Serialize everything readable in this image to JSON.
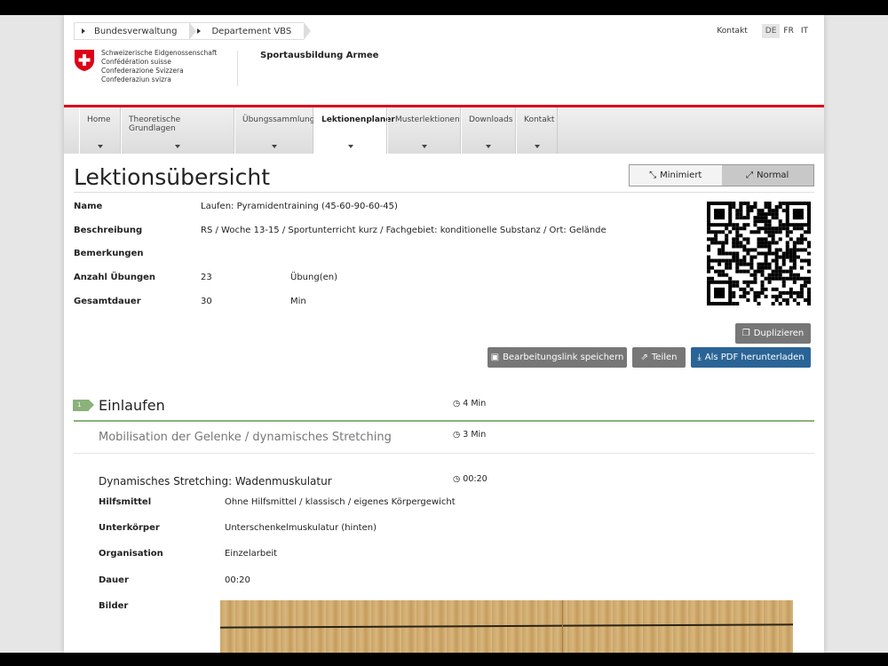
{
  "breadcrumbs": [
    "Bundesverwaltung",
    "Departement VBS"
  ],
  "top_links": {
    "kontakt": "Kontakt",
    "languages": [
      "DE",
      "FR",
      "IT"
    ],
    "active_language": "DE"
  },
  "federation": [
    "Schweizerische Eidgenossenschaft",
    "Confédération suisse",
    "Confederazione Svizzera",
    "Confederaziun svizra"
  ],
  "site_title": "Sportausbildung Armee",
  "nav": [
    "Home",
    "Theoretische Grundlagen",
    "Übungssammlung",
    "Lektionenplaner",
    "Musterlektionen",
    "Downloads",
    "Kontakt"
  ],
  "nav_active": "Lektionenplaner",
  "page_title": "Lektionsübersicht",
  "view_toggle": {
    "minimiert": "Minimiert",
    "normal": "Normal",
    "active": "Normal"
  },
  "details": {
    "name_label": "Name",
    "name": "Laufen: Pyramidentraining (45-60-90-60-45)",
    "beschreibung_label": "Beschreibung",
    "beschreibung": "RS / Woche 13-15 / Sportunterricht kurz / Fachgebiet: konditionelle Substanz / Ort: Gelände",
    "bemerkungen_label": "Bemerkungen",
    "anzahl_label": "Anzahl Übungen",
    "anzahl": "23",
    "anzahl_unit": "Übung(en)",
    "dauer_label": "Gesamtdauer",
    "dauer": "30",
    "dauer_unit": "Min"
  },
  "actions": {
    "duplizieren": "Duplizieren",
    "bearbeitungslink": "Bearbeitungslink speichern",
    "teilen": "Teilen",
    "pdf": "Als PDF herunterladen"
  },
  "section": {
    "number": "1",
    "title": "Einlaufen",
    "duration": "4 Min",
    "subsection": {
      "title": "Mobilisation der Gelenke / dynamisches Stretching",
      "duration": "3 Min"
    },
    "exercise": {
      "title": "Dynamisches Stretching: Wadenmuskulatur",
      "duration": "00:20",
      "hilfsmittel_label": "Hilfsmittel",
      "hilfsmittel": "Ohne Hilfsmittel / klassisch / eigenes Körpergewicht",
      "unterkoerper_label": "Unterkörper",
      "unterkoerper": "Unterschenkelmuskulatur (hinten)",
      "organisation_label": "Organisation",
      "organisation": "Einzelarbeit",
      "dauer_label": "Dauer",
      "dauer": "00:20",
      "bilder_label": "Bilder"
    }
  },
  "colors": {
    "swiss_red": "#dc0018",
    "section_green": "#8ab27a",
    "pdf_blue": "#2a6496"
  }
}
